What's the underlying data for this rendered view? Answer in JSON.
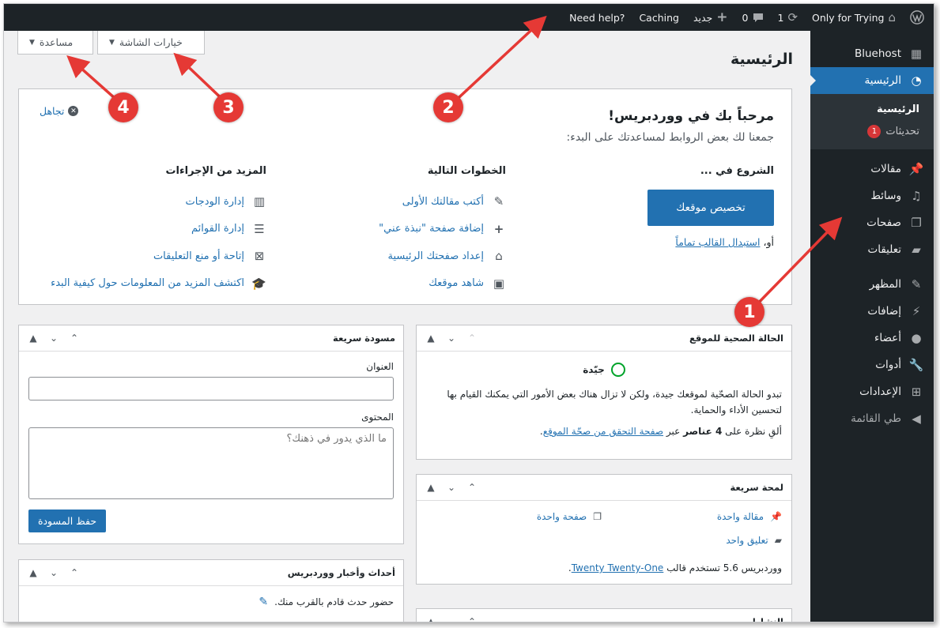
{
  "adminbar": {
    "wp_logo_icon": "wordpress-logo-icon",
    "site_name": "Only for Trying",
    "updates_count": "1",
    "comments_count": "0",
    "new_label": "جديد",
    "caching_label": "Caching",
    "need_help_label": "Need help?"
  },
  "screen_meta": {
    "screen_options_label": "خيارات الشاشة",
    "help_label": "مساعدة"
  },
  "page_title": "الرئيسية",
  "sidebar": {
    "items": [
      {
        "label": "Bluehost",
        "icon": "grid-icon"
      },
      {
        "label": "الرئيسية",
        "icon": "dashboard-icon",
        "active": true
      },
      {
        "label": "مقالات",
        "icon": "pin-icon"
      },
      {
        "label": "وسائط",
        "icon": "media-icon"
      },
      {
        "label": "صفحات",
        "icon": "pages-icon"
      },
      {
        "label": "تعليقات",
        "icon": "comments-icon"
      },
      {
        "label": "المظهر",
        "icon": "appearance-icon"
      },
      {
        "label": "إضافات",
        "icon": "plugins-icon"
      },
      {
        "label": "أعضاء",
        "icon": "users-icon"
      },
      {
        "label": "أدوات",
        "icon": "tools-icon"
      },
      {
        "label": "الإعدادات",
        "icon": "settings-icon"
      },
      {
        "label": "طي القائمة",
        "icon": "collapse-icon"
      }
    ],
    "submenu": {
      "home": "الرئيسية",
      "updates": "تحديثات",
      "updates_badge": "1"
    }
  },
  "welcome": {
    "title": "مرحباً بك في ووردبريس!",
    "about": "جمعنا لك بعض الروابط لمساعدتك على البدء:",
    "dismiss": "تجاهل",
    "get_started": {
      "heading": "الشروع في ...",
      "button": "تخصيص موقعك",
      "or_text": "أو،",
      "or_link": "استبدال القالب تماماً"
    },
    "next_steps": {
      "heading": "الخطوات التالية",
      "links": [
        {
          "label": "أكتب مقالتك الأولى",
          "icon": "edit-icon"
        },
        {
          "label": "إضافة صفحة \"نبذة عني\"",
          "icon": "plus-icon"
        },
        {
          "label": "إعداد صفحتك الرئيسية",
          "icon": "home-icon"
        },
        {
          "label": "شاهد موقعك",
          "icon": "view-icon"
        }
      ]
    },
    "more_actions": {
      "heading": "المزيد من الإجراءات",
      "links": [
        {
          "label": "إدارة الودجات",
          "icon": "widgets-icon"
        },
        {
          "label": "إدارة القوائم",
          "icon": "menus-icon"
        },
        {
          "label": "إتاحة أو منع التعليقات",
          "icon": "comments-toggle-icon"
        },
        {
          "label": "اكتشف المزيد من المعلومات حول كيفية البدء",
          "icon": "learn-icon"
        }
      ]
    }
  },
  "site_health": {
    "title": "الحالة الصحية للموقع",
    "status": "جيّدة",
    "description": "تبدو الحالة الصحّية لموقعك جيدة، ولكن لا تزال هناك بعض الأمور التي يمكنك القيام بها لتحسين الأداء والحماية.",
    "items_prefix": "ألقِ نظرة على",
    "items_count": "4 عناصر",
    "items_mid": "عبر",
    "items_link": "صفحة التحقق من صحّة الموقع",
    "items_end": "."
  },
  "at_a_glance": {
    "title": "لمحة سريعة",
    "post": "مقالة واحدة",
    "page": "صفحة واحدة",
    "comment": "تعليق واحد",
    "version_text": "ووردبريس 5.6 تستخدم قالب",
    "theme_link": "Twenty Twenty-One",
    "theme_end": "."
  },
  "activity": {
    "title": "النشاط"
  },
  "quick_draft": {
    "title": "مسودة سريعة",
    "title_label": "العنوان",
    "content_label": "المحتوى",
    "content_placeholder": "ما الذي يدور في ذهنك؟",
    "save_button": "حفظ المسودة"
  },
  "events": {
    "title": "أحداث وأخبار ووردبريس",
    "text": "حضور حدث قادم بالقرب منك."
  },
  "annotations": {
    "n1": "1",
    "n2": "2",
    "n3": "3",
    "n4": "4",
    "color": "#e53935"
  }
}
